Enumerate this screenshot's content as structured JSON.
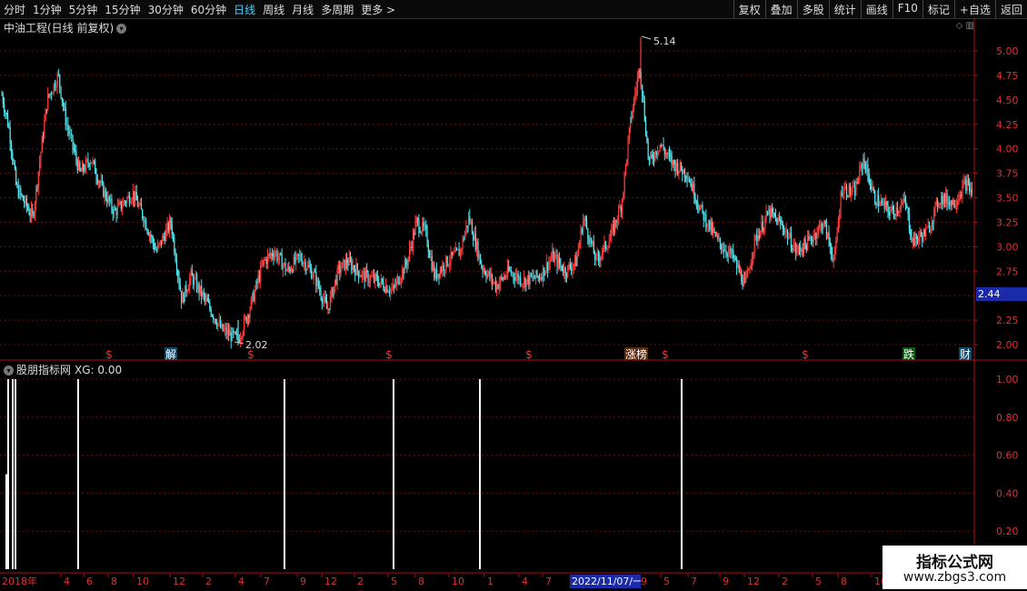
{
  "toolbar": {
    "left": [
      "分时",
      "1分钟",
      "5分钟",
      "15分钟",
      "30分钟",
      "60分钟",
      "日线",
      "周线",
      "月线",
      "多周期",
      "更多 >"
    ],
    "active_index": 6,
    "right": [
      "复权",
      "叠加",
      "多股",
      "统计",
      "画线",
      "F10",
      "标记",
      "+自选",
      "返回"
    ]
  },
  "chart": {
    "title": "中油工程(日线 前复权)",
    "price_axis": [
      "5.00",
      "4.75",
      "4.50",
      "4.25",
      "4.00",
      "3.75",
      "3.50",
      "3.25",
      "3.00",
      "2.75",
      "2.25",
      "2.00"
    ],
    "price_min": 2.0,
    "price_max": 5.0,
    "current_price": "2.44",
    "high_label": "5.14",
    "low_label": "2.02",
    "markers": [
      "$",
      "解",
      "$",
      "$",
      "$",
      "涨榜",
      "$",
      "$",
      "跌",
      "财"
    ],
    "up_color": "#ff3b3b",
    "down_color": "#54e8f0"
  },
  "indicator": {
    "title": "股朋指标网",
    "value_text": "XG: 0.00",
    "axis": [
      "1.00",
      "0.80",
      "0.60",
      "0.40",
      "0.20"
    ]
  },
  "x_axis": {
    "labels": [
      "2018年",
      "4",
      "6",
      "8",
      "10",
      "12",
      "2",
      "4",
      "7",
      "9",
      "12",
      "2",
      "5",
      "8",
      "10",
      "1",
      "4",
      "7",
      "9",
      "5",
      "7",
      "9",
      "12",
      "2",
      "5",
      "8",
      "10",
      "1"
    ],
    "selected_date": "2022/11/07/一"
  },
  "watermark": {
    "line1": "指标公式网",
    "line2": "www.zbgs3.com"
  }
}
